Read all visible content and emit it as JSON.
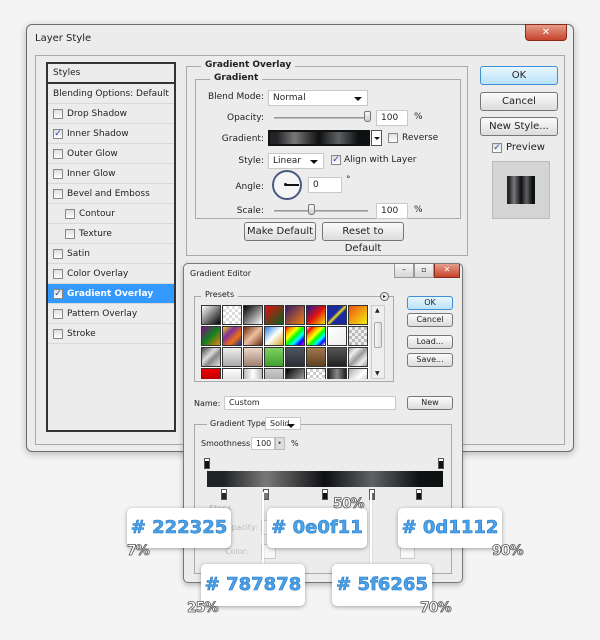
{
  "window": {
    "title": "Layer Style",
    "close_icon": "close-icon"
  },
  "styles_panel": {
    "header": "Styles",
    "blending": "Blending Options: Default",
    "items": [
      {
        "label": "Drop Shadow",
        "checked": false,
        "sub": false
      },
      {
        "label": "Inner Shadow",
        "checked": true,
        "sub": false
      },
      {
        "label": "Outer Glow",
        "checked": false,
        "sub": false
      },
      {
        "label": "Inner Glow",
        "checked": false,
        "sub": false
      },
      {
        "label": "Bevel and Emboss",
        "checked": false,
        "sub": false
      },
      {
        "label": "Contour",
        "checked": false,
        "sub": true
      },
      {
        "label": "Texture",
        "checked": false,
        "sub": true
      },
      {
        "label": "Satin",
        "checked": false,
        "sub": false
      },
      {
        "label": "Color Overlay",
        "checked": false,
        "sub": false
      },
      {
        "label": "Gradient Overlay",
        "checked": true,
        "sub": false,
        "selected": true
      },
      {
        "label": "Pattern Overlay",
        "checked": false,
        "sub": false
      },
      {
        "label": "Stroke",
        "checked": false,
        "sub": false
      }
    ]
  },
  "gradient_overlay": {
    "section_title": "Gradient Overlay",
    "group_title": "Gradient",
    "blend_mode_label": "Blend Mode:",
    "blend_mode_value": "Normal",
    "opacity_label": "Opacity:",
    "opacity_value": "100",
    "opacity_unit": "%",
    "opacity_level": 1.0,
    "gradient_label": "Gradient:",
    "reverse_label": "Reverse",
    "reverse_checked": false,
    "style_label": "Style:",
    "style_value": "Linear",
    "align_label": "Align with Layer",
    "align_checked": true,
    "angle_label": "Angle:",
    "angle_value": "0",
    "angle_unit": "°",
    "scale_label": "Scale:",
    "scale_value": "100",
    "scale_unit": "%",
    "scale_level": 0.4,
    "make_default": "Make Default",
    "reset_default": "Reset to Default"
  },
  "side_buttons": {
    "ok": "OK",
    "cancel": "Cancel",
    "new_style": "New Style...",
    "preview_label": "Preview",
    "preview_checked": true
  },
  "gradient_editor": {
    "title": "Gradient Editor",
    "presets_label": "Presets",
    "ok": "OK",
    "cancel": "Cancel",
    "load": "Load...",
    "save": "Save...",
    "name_label": "Name:",
    "name_value": "Custom",
    "new_button": "New",
    "type_label": "Gradient Type:",
    "type_value": "Solid",
    "smoothness_label": "Smoothness:",
    "smoothness_value": "100",
    "smoothness_unit": "%",
    "stops_label": "Stops",
    "opacity_ghost": "Opacity:",
    "color_ghost": "Color:",
    "preset_swatches": [
      "linear-gradient(135deg,#fff,#000)",
      "repeating-conic-gradient(#ddd 0 25%,#fff 0 50%) 0 0/6px 6px",
      "linear-gradient(135deg,#000,#fff)",
      "linear-gradient(135deg,#e01010,#0a6020)",
      "linear-gradient(135deg,#3a1a6a,#f08010)",
      "linear-gradient(135deg,#1a1aa0,#e01010,#f0e000)",
      "linear-gradient(135deg,#1a2aa0 40%,#f0e010 50%,#1a2aa0 60%)",
      "linear-gradient(135deg,#f05010,#f0f010)",
      "linear-gradient(135deg,#801080,#108020,#f08010)",
      "linear-gradient(135deg,#f0d010,#8030a0,#f07010,#1030a0)",
      "linear-gradient(135deg,#6a3010,#f0c0a0,#6a3010)",
      "linear-gradient(135deg,#2080e0,#fff,#d0a020)",
      "linear-gradient(135deg,red,orange,yellow,lime,cyan,blue,magenta)",
      "linear-gradient(135deg,#fff,red,orange,yellow,lime,cyan,blue,#fff)",
      "linear-gradient(135deg,#fff,#eee)",
      "repeating-conic-gradient(#bbb 0 25%,#eee 0 50%) 0 0/6px 6px",
      "linear-gradient(135deg,#444,#ddd 40%,#888 60%,#ddd)",
      "linear-gradient(#eee,#aaa)",
      "linear-gradient(#e8d8c8,#a08070)",
      "linear-gradient(#80d060,#40a030)",
      "linear-gradient(#505560,#2a2d35)",
      "linear-gradient(#a07850,#604020)",
      "linear-gradient(#555,#222)",
      "linear-gradient(135deg,#999,#eee,#999,#eee,#999)",
      "linear-gradient(#e00,#900)",
      "linear-gradient(#fff,#ccc)",
      "linear-gradient(90deg,#bbb,#fff,#bbb)",
      "linear-gradient(#ccc,#999)",
      "linear-gradient(135deg,#000,#ccc)",
      "repeating-conic-gradient(#ccc 0 25%,#fff 0 50%) 0 0/6px 6px",
      "linear-gradient(90deg,#222,#888,#222)",
      "linear-gradient(135deg,#aaa,#fff,#aaa)"
    ]
  },
  "gradient": {
    "stops": [
      {
        "position": 7,
        "color": "#222325"
      },
      {
        "position": 25,
        "color": "#787878"
      },
      {
        "position": 50,
        "color": "#0e0f11"
      },
      {
        "position": 70,
        "color": "#5f6265"
      },
      {
        "position": 90,
        "color": "#0d1112"
      }
    ],
    "end_color": "#0d1112",
    "start_color": "#222325"
  },
  "callouts": [
    {
      "hex": "# 222325",
      "pct": "7%"
    },
    {
      "hex": "# 787878",
      "pct": "25%"
    },
    {
      "hex": "# 0e0f11",
      "pct": "50%"
    },
    {
      "hex": "# 5f6265",
      "pct": "70%"
    },
    {
      "hex": "# 0d1112",
      "pct": "90%"
    }
  ]
}
